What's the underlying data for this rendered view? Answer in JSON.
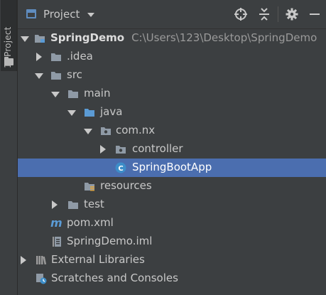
{
  "sidebar": {
    "tab_label": "1: Project"
  },
  "header": {
    "title": "Project"
  },
  "tree": {
    "root": {
      "name": "SpringDemo",
      "path": "C:\\Users\\123\\Desktop\\SpringDemo"
    },
    "idea": ".idea",
    "src": "src",
    "main": "main",
    "java": "java",
    "package": "com.nx",
    "controller": "controller",
    "app_class": "SpringBootApp",
    "resources": "resources",
    "test": "test",
    "pom": "pom.xml",
    "iml": "SpringDemo.iml",
    "external": "External Libraries",
    "scratches": "Scratches and Consoles"
  },
  "colors": {
    "selection": "#4b6eaf",
    "folder": "#8f9aa6",
    "source_folder": "#5b9bd5",
    "class_icon": "#3d8ec9"
  }
}
